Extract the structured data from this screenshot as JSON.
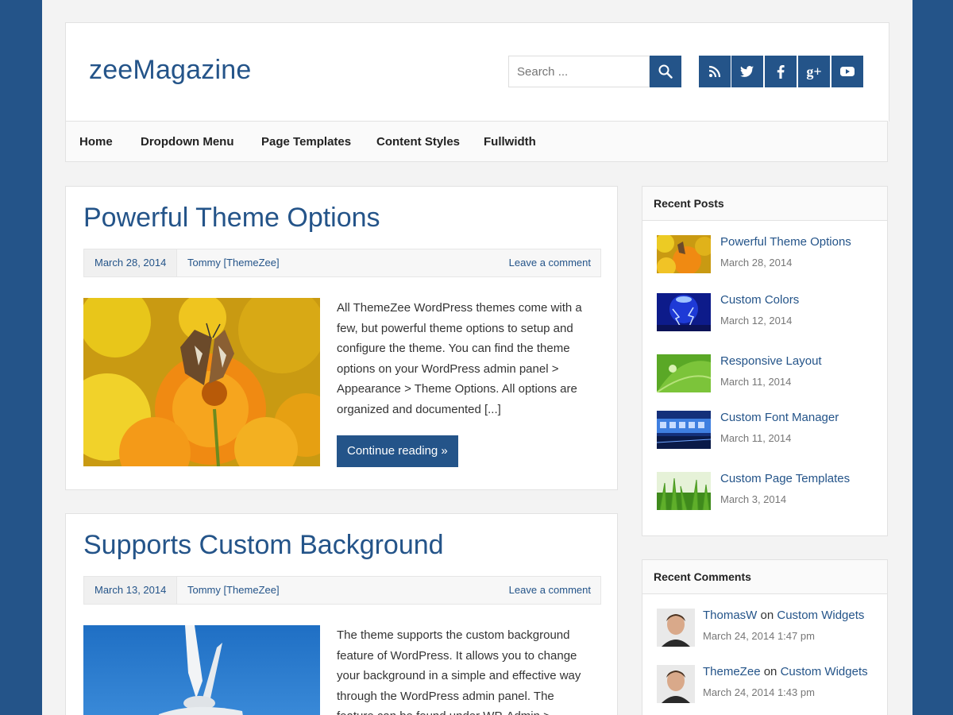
{
  "site": {
    "title": "zeeMagazine"
  },
  "search": {
    "placeholder": "Search ..."
  },
  "social": [
    {
      "icon": "rss-icon",
      "glyph": "∷"
    },
    {
      "icon": "twitter-icon",
      "glyph": "t"
    },
    {
      "icon": "facebook-icon",
      "glyph": "f"
    },
    {
      "icon": "google-plus-icon",
      "glyph": "g+"
    },
    {
      "icon": "youtube-icon",
      "glyph": "▶"
    }
  ],
  "nav": {
    "items": [
      "Home",
      "Dropdown Menu",
      "Page Templates",
      "Content Styles",
      "Fullwidth"
    ]
  },
  "posts": [
    {
      "title": "Powerful Theme Options",
      "date": "March 28, 2014",
      "author": "Tommy [ThemeZee]",
      "comment_link": "Leave a comment",
      "excerpt": "All ThemeZee WordPress themes come with a few, but powerful theme options to setup and configure the theme. You can find the theme options on your WordPress admin panel > Appearance > Theme Options. All options are organized and documented [...]",
      "button": "Continue reading »"
    },
    {
      "title": "Supports Custom Background",
      "date": "March 13, 2014",
      "author": "Tommy [ThemeZee]",
      "comment_link": "Leave a comment",
      "excerpt": "The theme supports the custom background feature of WordPress. It allows you to change your background in a simple and effective way through the WordPress admin panel. The feature can be found under WP-Admin > Appearance >"
    }
  ],
  "recent_posts": {
    "title": "Recent Posts",
    "items": [
      {
        "title": "Powerful Theme Options",
        "date": "March 28, 2014"
      },
      {
        "title": "Custom Colors",
        "date": "March 12, 2014"
      },
      {
        "title": "Responsive Layout",
        "date": "March 11, 2014"
      },
      {
        "title": "Custom Font Manager",
        "date": "March 11, 2014"
      },
      {
        "title": "Custom Page Templates",
        "date": "March 3, 2014"
      }
    ]
  },
  "recent_comments": {
    "title": "Recent Comments",
    "items": [
      {
        "author": "ThomasW",
        "on": "on",
        "post": "Custom Widgets",
        "date": "March 24, 2014 1:47 pm"
      },
      {
        "author": "ThemeZee",
        "on": "on",
        "post": "Custom Widgets",
        "date": "March 24, 2014 1:43 pm"
      }
    ]
  },
  "colors": {
    "primary": "#245489",
    "background": "#f3f3f3",
    "panel": "#ffffff"
  }
}
